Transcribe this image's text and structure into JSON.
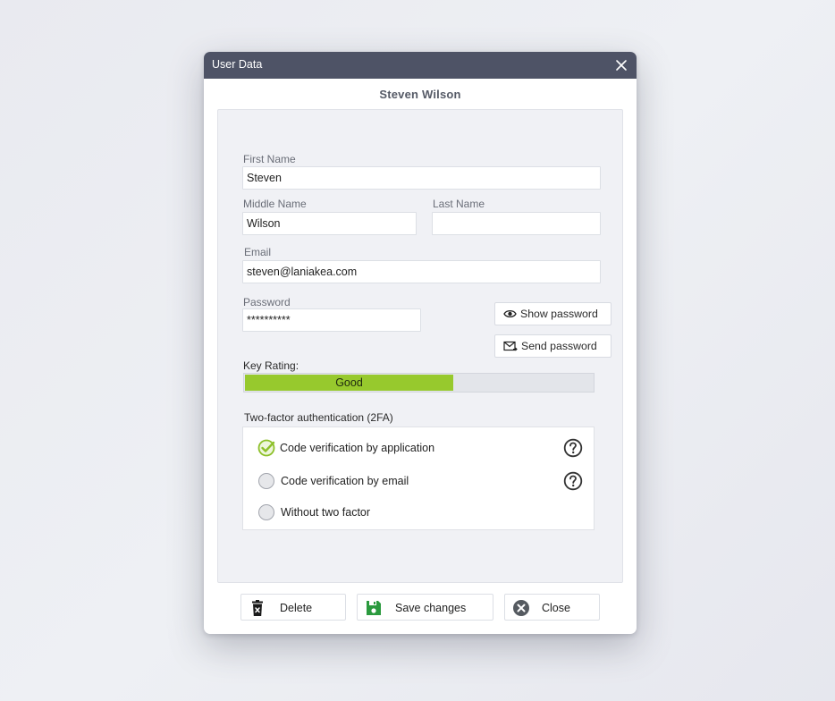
{
  "window": {
    "title": "User Data"
  },
  "user": {
    "display_name": "Steven Wilson"
  },
  "form": {
    "first_name": {
      "label": "First Name",
      "value": "Steven"
    },
    "middle_name": {
      "label": "Middle Name",
      "value": "Wilson"
    },
    "last_name": {
      "label": "Last Name",
      "value": ""
    },
    "email": {
      "label": "Email",
      "value": "steven@laniakea.com"
    },
    "password": {
      "label": "Password",
      "value": "**********"
    },
    "show_password_label": "Show password",
    "send_password_label": "Send password"
  },
  "key_rating": {
    "label": "Key Rating:",
    "text": "Good",
    "level": 0.6,
    "color": "#97c92d"
  },
  "two_factor": {
    "title": "Two-factor authentication (2FA)",
    "options": [
      {
        "label": "Code verification by application",
        "selected": true,
        "help": true
      },
      {
        "label": "Code verification by email",
        "selected": false,
        "help": true
      },
      {
        "label": "Without two factor",
        "selected": false,
        "help": false
      }
    ]
  },
  "footer": {
    "delete_label": "Delete",
    "save_label": "Save changes",
    "close_label": "Close"
  },
  "colors": {
    "titlebar": "#4e5366",
    "accent_green": "#8dc02a",
    "save_icon_green": "#2b9a3e"
  },
  "icons": [
    "close-icon",
    "eye-icon",
    "mail-icon",
    "check-circle-icon",
    "help-icon",
    "trash-icon",
    "save-icon",
    "close-circle-icon"
  ]
}
